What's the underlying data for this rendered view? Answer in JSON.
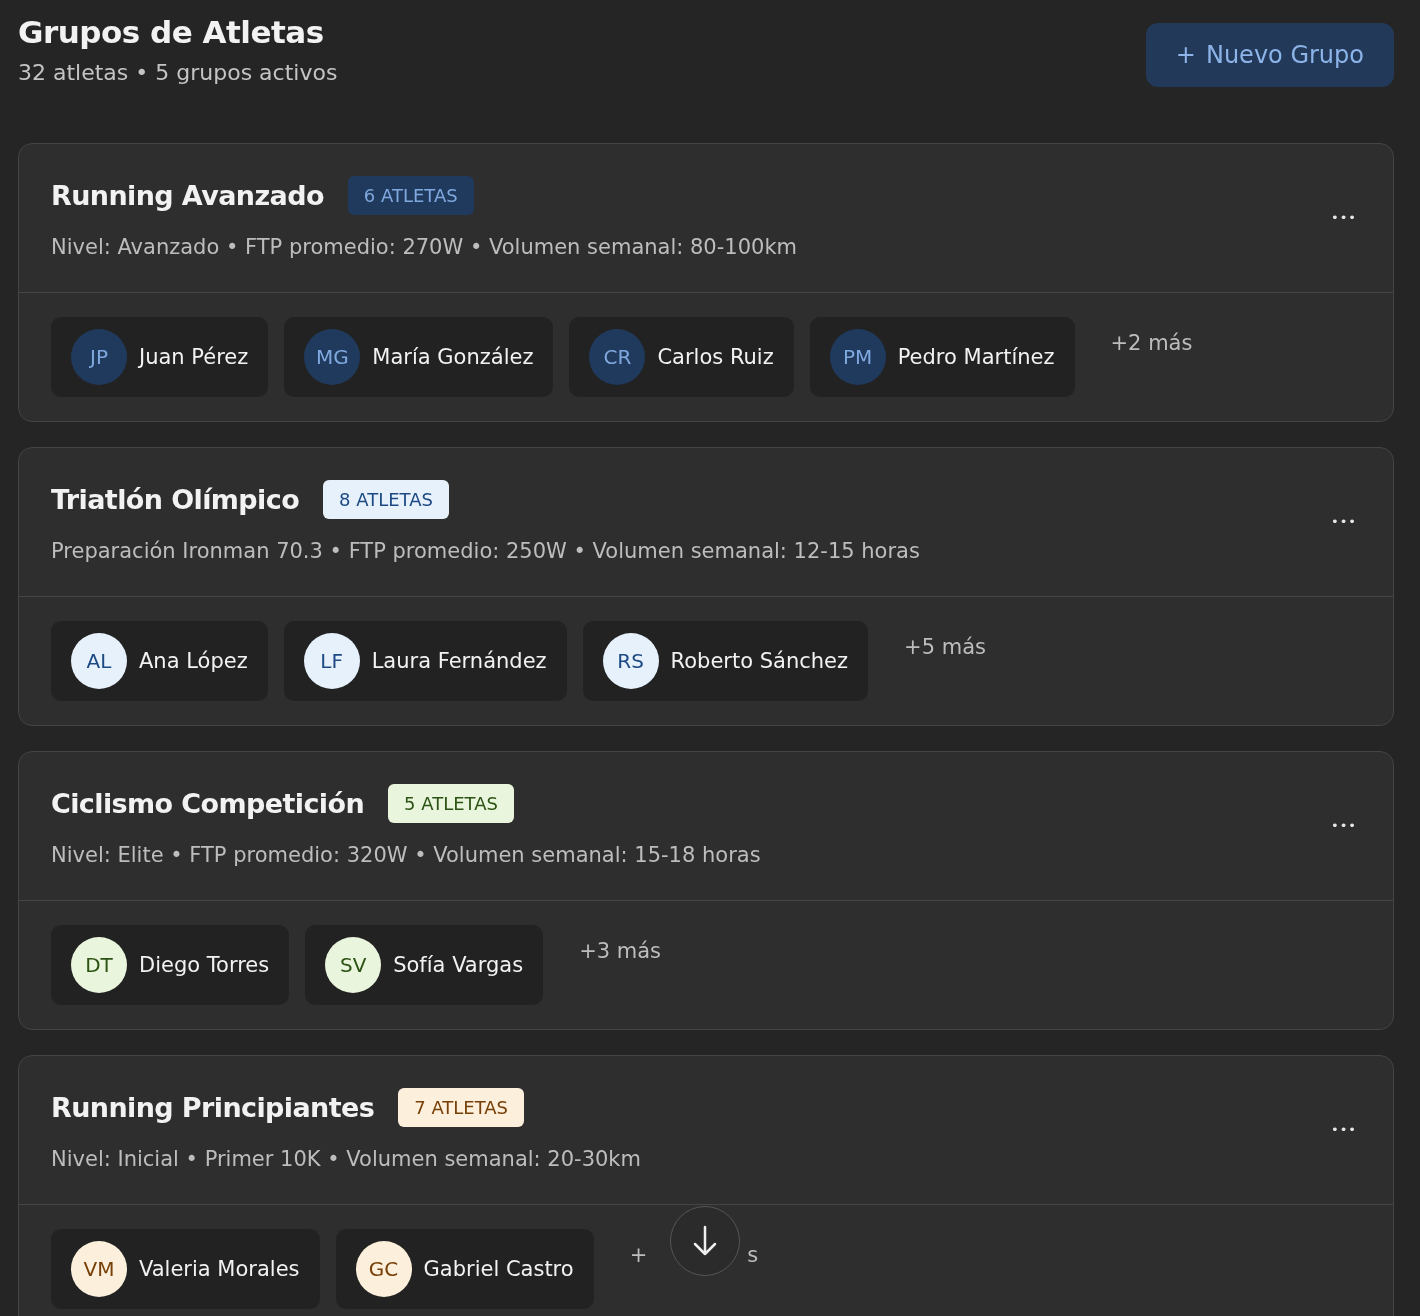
{
  "header": {
    "title": "Grupos de Atletas",
    "subtitle": "32 atletas • 5 grupos activos",
    "new_button": {
      "icon": "+",
      "label": "Nuevo Grupo"
    }
  },
  "groups": [
    {
      "name": "Running Avanzado",
      "badge": "6 ATLETAS",
      "color": "#203a5e",
      "details": "Nivel: Avanzado • FTP promedio: 270W • Volumen semanal: 80-100km",
      "menu": "•••",
      "members": [
        {
          "initials": "JP",
          "name": "Juan Pérez"
        },
        {
          "initials": "MG",
          "name": "María González"
        },
        {
          "initials": "CR",
          "name": "Carlos Ruiz"
        },
        {
          "initials": "PM",
          "name": "Pedro Martínez"
        }
      ],
      "more": "+2 más"
    },
    {
      "name": "Triatlón Olímpico",
      "badge": "8 ATLETAS",
      "color": "#e7f1fc",
      "details": "Preparación Ironman 70.3 • FTP promedio: 250W • Volumen semanal: 12-15 horas",
      "menu": "•••",
      "members": [
        {
          "initials": "AL",
          "name": "Ana López"
        },
        {
          "initials": "LF",
          "name": "Laura Fernández"
        },
        {
          "initials": "RS",
          "name": "Roberto Sánchez"
        }
      ],
      "more": "+5 más"
    },
    {
      "name": "Ciclismo Competición",
      "badge": "5 ATLETAS",
      "color": "#e9f5dc",
      "details": "Nivel: Elite • FTP promedio: 320W • Volumen semanal: 15-18 horas",
      "menu": "•••",
      "members": [
        {
          "initials": "DT",
          "name": "Diego Torres"
        },
        {
          "initials": "SV",
          "name": "Sofía Vargas"
        }
      ],
      "more": "+3 más"
    },
    {
      "name": "Running Principiantes",
      "badge": "7 ATLETAS",
      "color": "#fcefdc",
      "details": "Nivel: Inicial • Primer 10K • Volumen semanal: 20-30km",
      "menu": "•••",
      "members": [
        {
          "initials": "VM",
          "name": "Valeria Morales"
        },
        {
          "initials": "GC",
          "name": "Gabriel Castro"
        }
      ],
      "more": "+",
      "more_end": "s"
    }
  ]
}
